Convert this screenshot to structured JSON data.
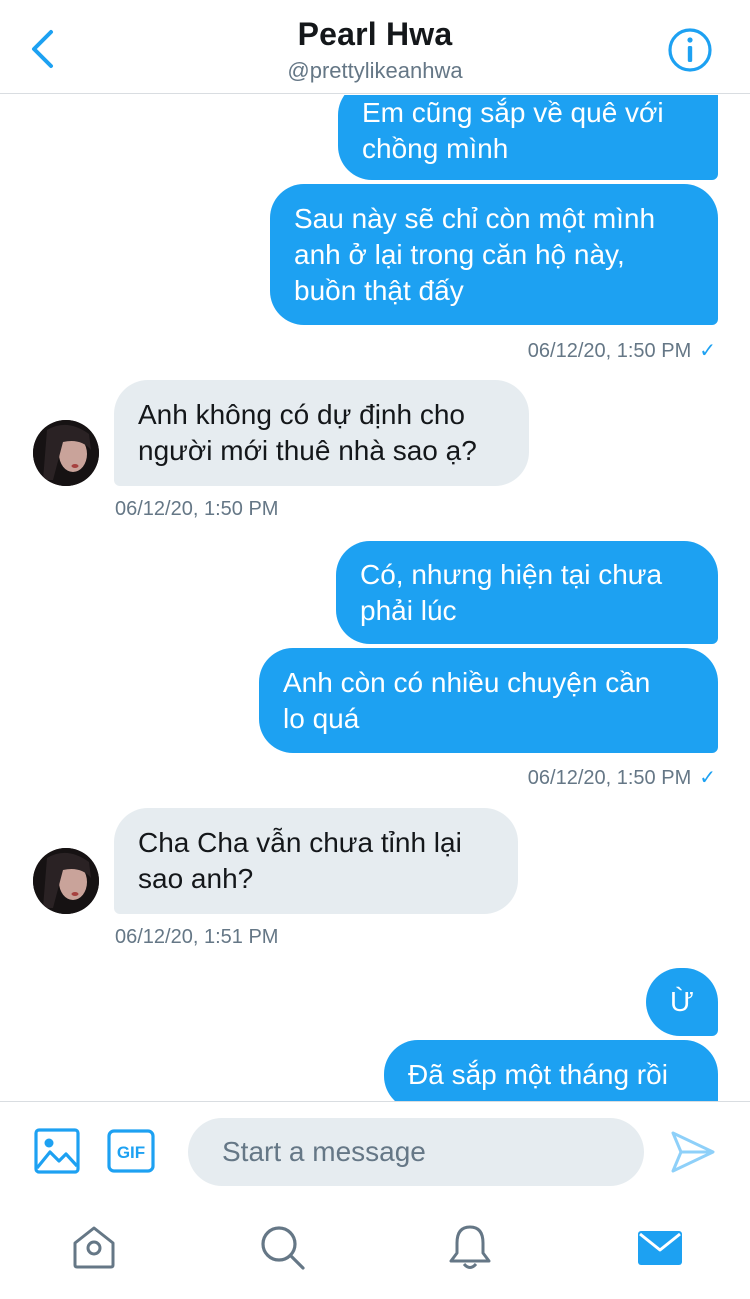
{
  "header": {
    "name": "Pearl Hwa",
    "handle": "@prettylikeanhwa"
  },
  "messages": [
    {
      "dir": "out",
      "lines": [
        "Em cũng sắp về quê với",
        "chồng mình"
      ]
    },
    {
      "dir": "out",
      "lines": [
        "Sau này sẽ chỉ còn một mình",
        "anh ở lại trong căn hộ này,",
        "buồn thật đấy"
      ]
    },
    {
      "dir": "out-ts",
      "text": "06/12/20, 1:50 PM",
      "check": "✓"
    },
    {
      "dir": "in",
      "lines": [
        "Anh không có dự định cho",
        "người mới thuê nhà sao ạ?"
      ]
    },
    {
      "dir": "in-ts",
      "text": "06/12/20, 1:50 PM"
    },
    {
      "dir": "out",
      "lines": [
        "Có, nhưng hiện tại chưa",
        "phải lúc"
      ]
    },
    {
      "dir": "out",
      "lines": [
        "Anh còn có nhiều chuyện cần",
        "lo quá"
      ]
    },
    {
      "dir": "out-ts",
      "text": "06/12/20, 1:50 PM",
      "check": "✓"
    },
    {
      "dir": "in",
      "lines": [
        "Cha Cha vẫn chưa tỉnh lại",
        "sao anh?"
      ]
    },
    {
      "dir": "in-ts",
      "text": "06/12/20, 1:51 PM"
    },
    {
      "dir": "out",
      "lines": [
        "Ừ"
      ]
    },
    {
      "dir": "out",
      "lines": [
        "Đã sắp một tháng rồi"
      ]
    }
  ],
  "composer": {
    "placeholder": "Start a message",
    "gif_label": "GIF"
  },
  "icons": {
    "back": "chevron-left-icon",
    "info": "info-icon",
    "image": "image-icon",
    "gif": "gif-icon",
    "send": "send-icon",
    "home": "home-icon",
    "search": "search-icon",
    "notifications": "bell-icon",
    "messages": "mail-icon"
  },
  "colors": {
    "accent": "#1da1f2",
    "incoming_bubble": "#e6ecf0",
    "secondary_text": "#657786",
    "send_disabled": "#8ed0f9"
  }
}
